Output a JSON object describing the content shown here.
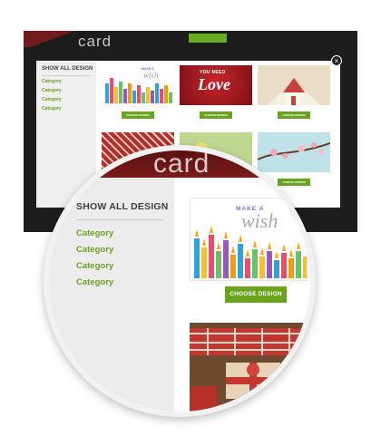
{
  "background": {
    "logo_text": "card"
  },
  "modal": {
    "sidebar_title": "SHOW ALL DESIGN",
    "categories": [
      "Category",
      "Category",
      "Category",
      "Category"
    ],
    "close_glyph": "×",
    "thumbs": [
      {
        "name": "make-a-wish",
        "button": "CHOOSE DESIGN"
      },
      {
        "name": "you-need-love",
        "button": "CHOOSE DESIGN",
        "text_top": "YOU NEED",
        "text_main": "Love"
      },
      {
        "name": "pop-up-house",
        "button": "CHOOSE DESIGN"
      },
      {
        "name": "gift-wrap",
        "button": ""
      },
      {
        "name": "flowers",
        "button": ""
      },
      {
        "name": "cherry-blossom",
        "button": "CHOOSE DESIGN"
      }
    ],
    "card_text_line1": "MAKE A",
    "card_text_line2": "wish"
  },
  "magnifier": {
    "logo_text": "card",
    "sidebar_title": "SHOW ALL DESIGN",
    "categories": [
      "Category",
      "Category",
      "Category",
      "Category"
    ],
    "card_text_line1": "MAKE A",
    "card_text_line2": "wish",
    "choose_button": "CHOOSE DESIGN"
  },
  "colors": {
    "accent": "#6aa31d",
    "dark": "#1d1d1d",
    "sidebar": "#ececec"
  }
}
